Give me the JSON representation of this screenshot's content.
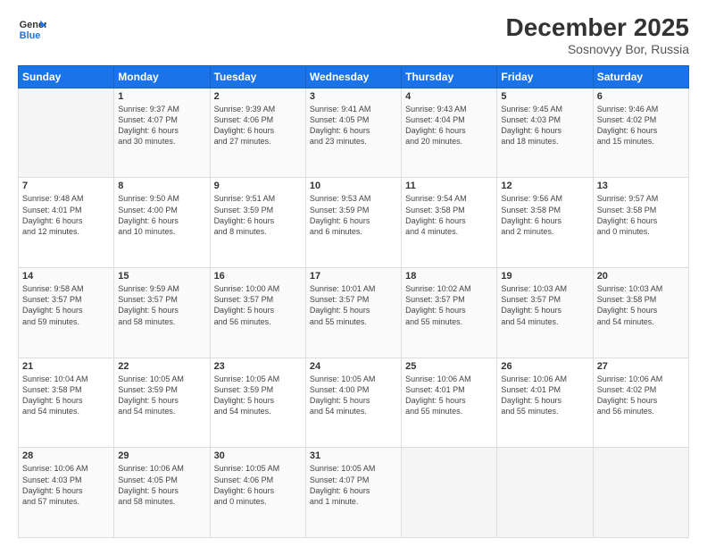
{
  "logo": {
    "line1": "General",
    "line2": "Blue"
  },
  "header": {
    "month": "December 2025",
    "location": "Sosnovyy Bor, Russia"
  },
  "weekdays": [
    "Sunday",
    "Monday",
    "Tuesday",
    "Wednesday",
    "Thursday",
    "Friday",
    "Saturday"
  ],
  "weeks": [
    [
      {
        "day": "",
        "content": ""
      },
      {
        "day": "1",
        "content": "Sunrise: 9:37 AM\nSunset: 4:07 PM\nDaylight: 6 hours\nand 30 minutes."
      },
      {
        "day": "2",
        "content": "Sunrise: 9:39 AM\nSunset: 4:06 PM\nDaylight: 6 hours\nand 27 minutes."
      },
      {
        "day": "3",
        "content": "Sunrise: 9:41 AM\nSunset: 4:05 PM\nDaylight: 6 hours\nand 23 minutes."
      },
      {
        "day": "4",
        "content": "Sunrise: 9:43 AM\nSunset: 4:04 PM\nDaylight: 6 hours\nand 20 minutes."
      },
      {
        "day": "5",
        "content": "Sunrise: 9:45 AM\nSunset: 4:03 PM\nDaylight: 6 hours\nand 18 minutes."
      },
      {
        "day": "6",
        "content": "Sunrise: 9:46 AM\nSunset: 4:02 PM\nDaylight: 6 hours\nand 15 minutes."
      }
    ],
    [
      {
        "day": "7",
        "content": "Sunrise: 9:48 AM\nSunset: 4:01 PM\nDaylight: 6 hours\nand 12 minutes."
      },
      {
        "day": "8",
        "content": "Sunrise: 9:50 AM\nSunset: 4:00 PM\nDaylight: 6 hours\nand 10 minutes."
      },
      {
        "day": "9",
        "content": "Sunrise: 9:51 AM\nSunset: 3:59 PM\nDaylight: 6 hours\nand 8 minutes."
      },
      {
        "day": "10",
        "content": "Sunrise: 9:53 AM\nSunset: 3:59 PM\nDaylight: 6 hours\nand 6 minutes."
      },
      {
        "day": "11",
        "content": "Sunrise: 9:54 AM\nSunset: 3:58 PM\nDaylight: 6 hours\nand 4 minutes."
      },
      {
        "day": "12",
        "content": "Sunrise: 9:56 AM\nSunset: 3:58 PM\nDaylight: 6 hours\nand 2 minutes."
      },
      {
        "day": "13",
        "content": "Sunrise: 9:57 AM\nSunset: 3:58 PM\nDaylight: 6 hours\nand 0 minutes."
      }
    ],
    [
      {
        "day": "14",
        "content": "Sunrise: 9:58 AM\nSunset: 3:57 PM\nDaylight: 5 hours\nand 59 minutes."
      },
      {
        "day": "15",
        "content": "Sunrise: 9:59 AM\nSunset: 3:57 PM\nDaylight: 5 hours\nand 58 minutes."
      },
      {
        "day": "16",
        "content": "Sunrise: 10:00 AM\nSunset: 3:57 PM\nDaylight: 5 hours\nand 56 minutes."
      },
      {
        "day": "17",
        "content": "Sunrise: 10:01 AM\nSunset: 3:57 PM\nDaylight: 5 hours\nand 55 minutes."
      },
      {
        "day": "18",
        "content": "Sunrise: 10:02 AM\nSunset: 3:57 PM\nDaylight: 5 hours\nand 55 minutes."
      },
      {
        "day": "19",
        "content": "Sunrise: 10:03 AM\nSunset: 3:57 PM\nDaylight: 5 hours\nand 54 minutes."
      },
      {
        "day": "20",
        "content": "Sunrise: 10:03 AM\nSunset: 3:58 PM\nDaylight: 5 hours\nand 54 minutes."
      }
    ],
    [
      {
        "day": "21",
        "content": "Sunrise: 10:04 AM\nSunset: 3:58 PM\nDaylight: 5 hours\nand 54 minutes."
      },
      {
        "day": "22",
        "content": "Sunrise: 10:05 AM\nSunset: 3:59 PM\nDaylight: 5 hours\nand 54 minutes."
      },
      {
        "day": "23",
        "content": "Sunrise: 10:05 AM\nSunset: 3:59 PM\nDaylight: 5 hours\nand 54 minutes."
      },
      {
        "day": "24",
        "content": "Sunrise: 10:05 AM\nSunset: 4:00 PM\nDaylight: 5 hours\nand 54 minutes."
      },
      {
        "day": "25",
        "content": "Sunrise: 10:06 AM\nSunset: 4:01 PM\nDaylight: 5 hours\nand 55 minutes."
      },
      {
        "day": "26",
        "content": "Sunrise: 10:06 AM\nSunset: 4:01 PM\nDaylight: 5 hours\nand 55 minutes."
      },
      {
        "day": "27",
        "content": "Sunrise: 10:06 AM\nSunset: 4:02 PM\nDaylight: 5 hours\nand 56 minutes."
      }
    ],
    [
      {
        "day": "28",
        "content": "Sunrise: 10:06 AM\nSunset: 4:03 PM\nDaylight: 5 hours\nand 57 minutes."
      },
      {
        "day": "29",
        "content": "Sunrise: 10:06 AM\nSunset: 4:05 PM\nDaylight: 5 hours\nand 58 minutes."
      },
      {
        "day": "30",
        "content": "Sunrise: 10:05 AM\nSunset: 4:06 PM\nDaylight: 6 hours\nand 0 minutes."
      },
      {
        "day": "31",
        "content": "Sunrise: 10:05 AM\nSunset: 4:07 PM\nDaylight: 6 hours\nand 1 minute."
      },
      {
        "day": "",
        "content": ""
      },
      {
        "day": "",
        "content": ""
      },
      {
        "day": "",
        "content": ""
      }
    ]
  ]
}
